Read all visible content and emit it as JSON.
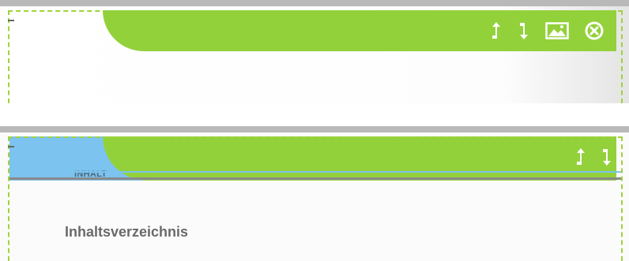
{
  "panel_1": {
    "toolbar_icons": [
      "arrow-up-icon",
      "arrow-down-icon",
      "image-icon",
      "close-icon"
    ]
  },
  "panel_2": {
    "tab_label": "INHALT",
    "toolbar_icons": [
      "arrow-up-icon",
      "arrow-down-icon"
    ],
    "heading": "Inhaltsverzeichnis"
  },
  "colors": {
    "accent_green": "#93d13b",
    "dashed_border_green": "#9ed33a",
    "tab_blue": "#7cc3ef",
    "heading_gray": "#6a6a6a"
  }
}
